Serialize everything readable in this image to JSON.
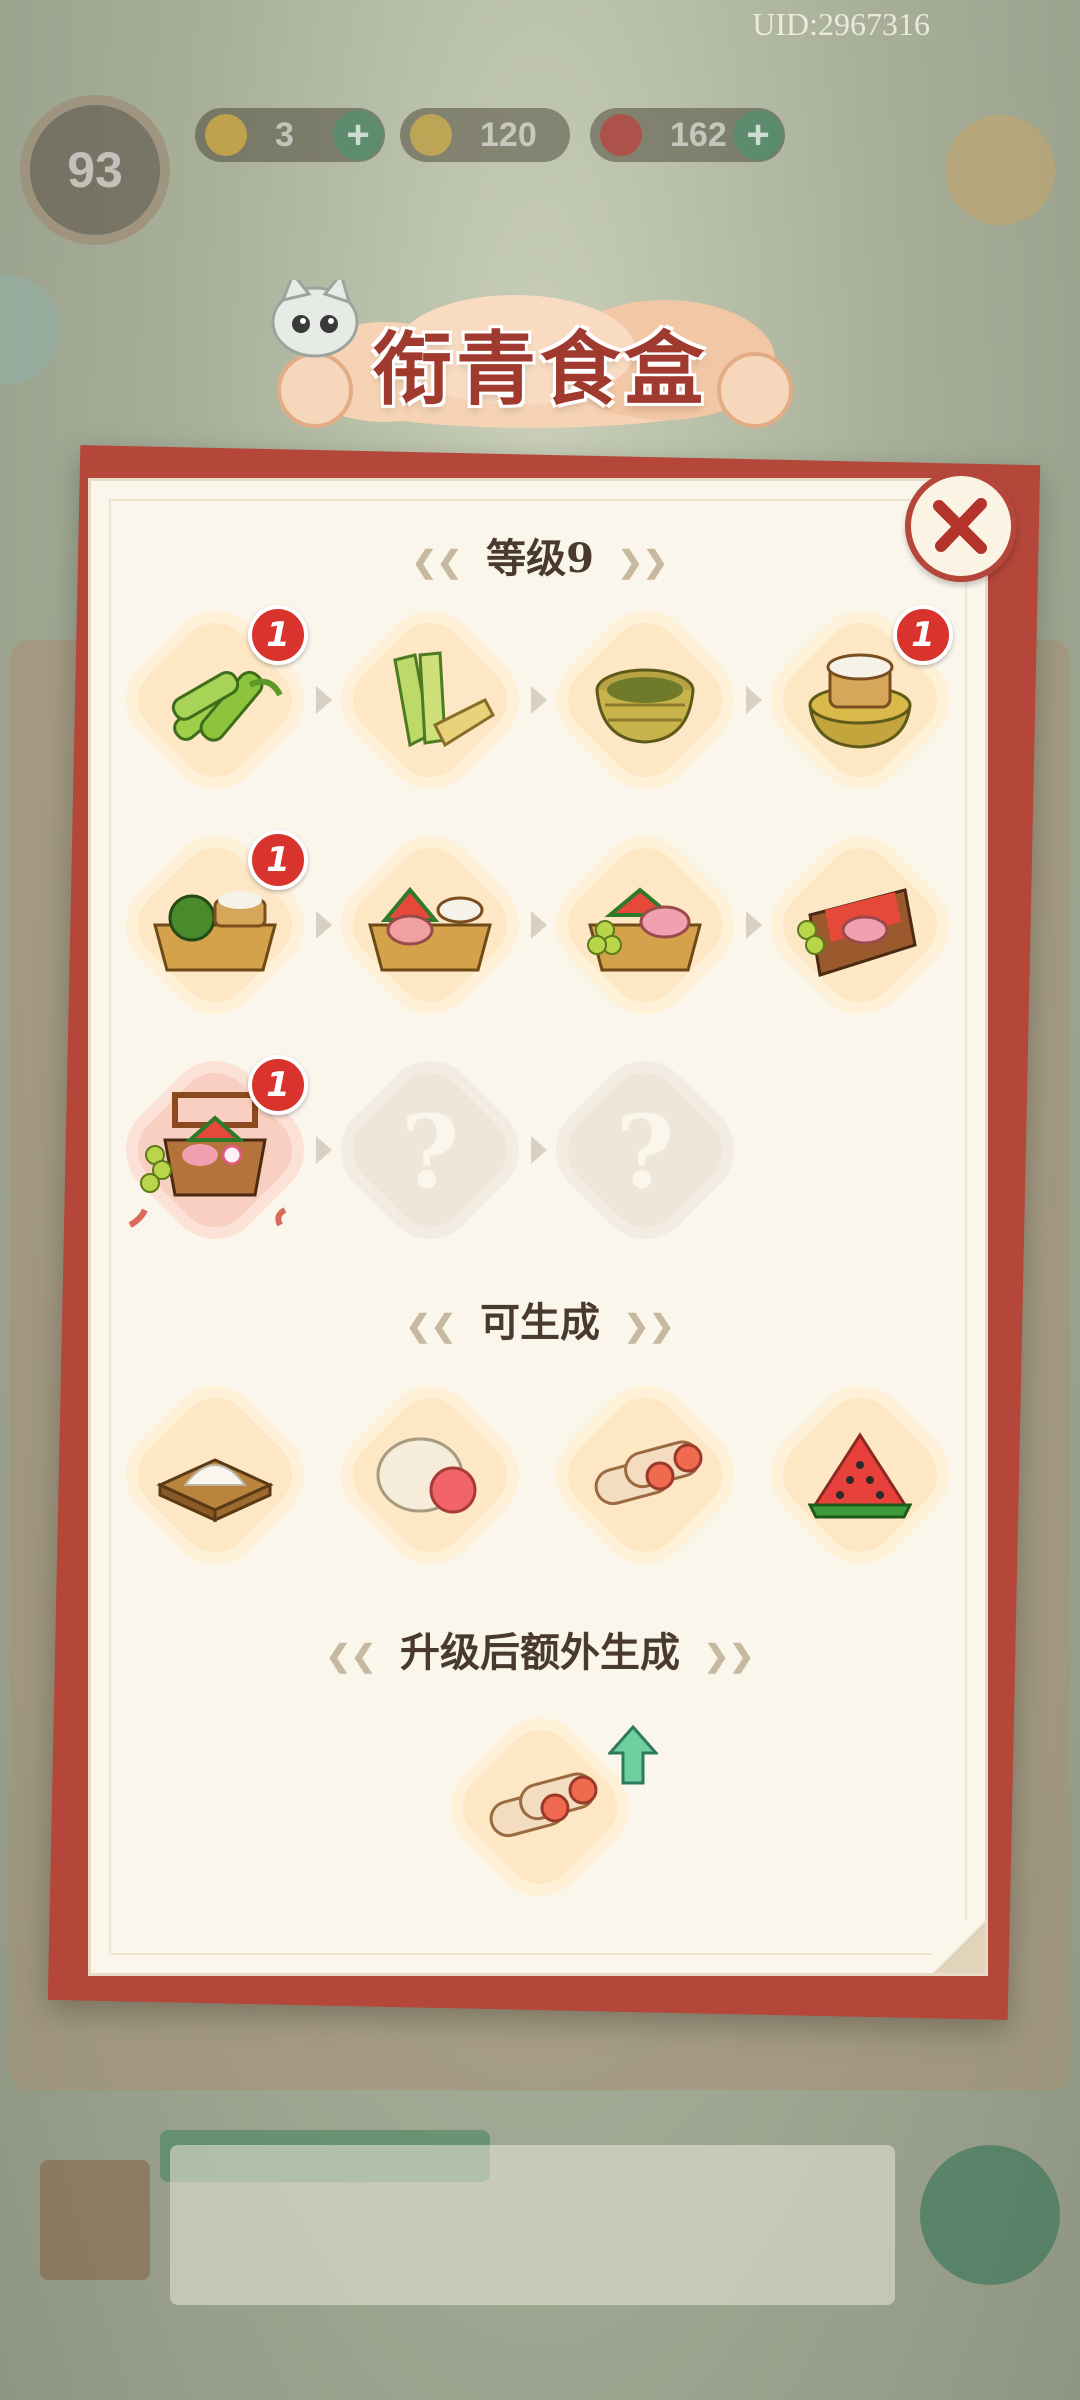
{
  "hud": {
    "uid": "UID:2967316",
    "level": "93",
    "energy": "3",
    "coins": "120",
    "gems": "162"
  },
  "dialog": {
    "title": "衔青食盒",
    "level_section": "等级9",
    "generate_section": "可生成",
    "upgrade_section": "升级后额外生成"
  },
  "chain": [
    {
      "item": "bamboo-stalks-icon",
      "badge": "1"
    },
    {
      "item": "bamboo-slats-icon",
      "badge": ""
    },
    {
      "item": "woven-basket-icon",
      "badge": ""
    },
    {
      "item": "rice-steamer-icon",
      "badge": "1"
    },
    {
      "item": "basket-watermelon-rice-icon",
      "badge": "1"
    },
    {
      "item": "basket-ham-rice-icon",
      "badge": ""
    },
    {
      "item": "basket-grapes-ham-icon",
      "badge": ""
    },
    {
      "item": "wooden-picnic-box-icon",
      "badge": ""
    },
    {
      "item": "deluxe-food-basket-icon",
      "badge": "1"
    },
    {
      "item": "locked-question-icon",
      "badge": ""
    },
    {
      "item": "locked-question-icon",
      "badge": ""
    }
  ],
  "locked_mark": "?",
  "generates": [
    {
      "item": "flour-tray-icon"
    },
    {
      "item": "steamed-buns-icon"
    },
    {
      "item": "spring-rolls-icon"
    },
    {
      "item": "watermelon-slice-icon"
    }
  ],
  "upgrade_extra": [
    {
      "item": "spring-rolls-icon"
    }
  ],
  "colors": {
    "frame_red": "#b4463a",
    "paper": "#fbf6ec",
    "badge_red": "#d8332c",
    "upgrade_arrow": "#6fcf9f"
  }
}
